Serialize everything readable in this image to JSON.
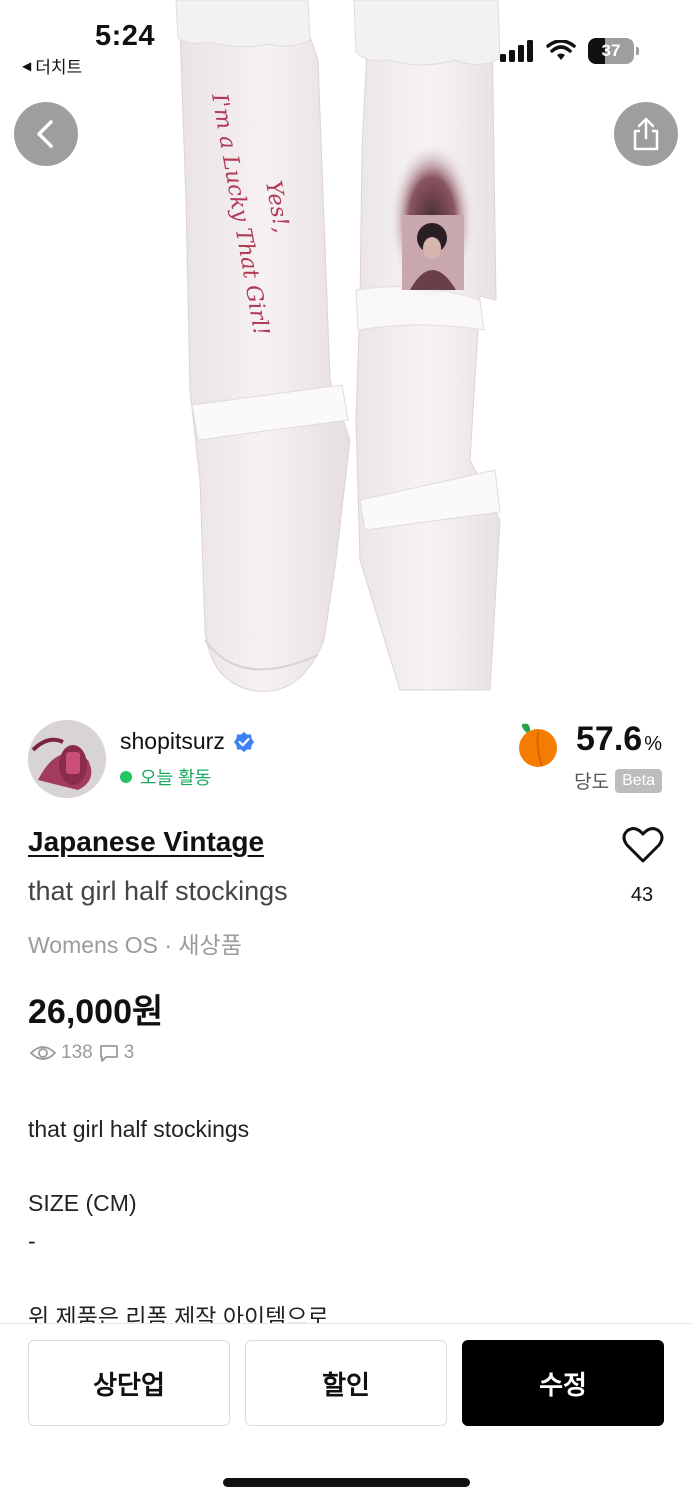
{
  "status_bar": {
    "time": "5:24",
    "back_app": "더치트",
    "battery": "37",
    "icons": [
      "cellular-signal-icon",
      "wifi-icon",
      "battery-icon"
    ]
  },
  "hero": {
    "image": "product-photo-white-lace-top-stockings",
    "printed_text": "I'm a Lucky Girl, Yes, That Girl!",
    "icons": [
      "back-arrow-icon",
      "share-icon"
    ]
  },
  "seller": {
    "name": "shopitsurz",
    "activity": "오늘 활동",
    "verified_icon": "verified-badge-icon",
    "score": "57.6",
    "score_unit": "%",
    "score_label": "당도",
    "beta": "Beta"
  },
  "product": {
    "brand": "Japanese Vintage",
    "title": "that girl half stockings",
    "meta": "Womens OS · 새상품",
    "price": "26,000원",
    "views": "138",
    "chats": "3",
    "likes": "43"
  },
  "description": {
    "line1": "that girl half stockings",
    "line2": "SIZE (CM)",
    "line3": "-",
    "line4": "위 제품은 리폼 제작 아이템으로"
  },
  "actions": {
    "bump": "상단업",
    "discount": "할인",
    "edit": "수정"
  },
  "colors": {
    "accent_green": "#22c55e",
    "primary_button": "#000000",
    "muted_text": "#9b9b9b",
    "verified_blue": "#3b82f6",
    "peach_orange": "#f57c00"
  }
}
